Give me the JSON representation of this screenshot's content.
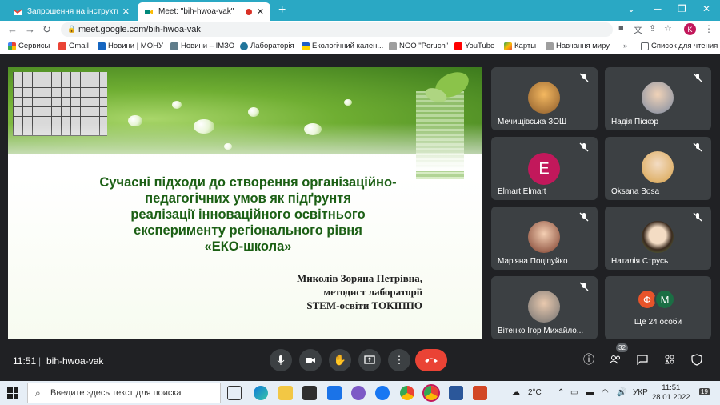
{
  "browser": {
    "tabs": [
      {
        "title": "Запрошення на інструктивно-м",
        "active": false,
        "icon": "gmail-icon"
      },
      {
        "title": "Meet: \"bih-hwoa-vak\"",
        "active": true,
        "icon": "meet-icon"
      }
    ],
    "url": "meet.google.com/bih-hwoa-vak",
    "profile_initial": "K",
    "bookmarks": [
      "Сервисы",
      "Gmail",
      "Новини | МОНУ",
      "Новини – ІМЗО",
      "Лабораторія",
      "Екологічний кален...",
      "NGO \"Poruch\"",
      "YouTube",
      "Карты",
      "Навчання миру"
    ],
    "reading_list": "Список для чтения"
  },
  "slide": {
    "title_lines": [
      "Сучасні підходи до створення організаційно-",
      "педагогічних умов як підґрунтя",
      "реалізації інноваційного освітнього",
      "експерименту регіонального рівня",
      "«ЕКО-школа»"
    ],
    "author_lines": [
      "Миколів Зоряна Петрівна,",
      "методист лабораторії",
      "STEM-освіти ТОКІППО"
    ]
  },
  "participants": [
    {
      "name": "Мечищівська ЗОШ",
      "avatar": "photo",
      "color": "#e0a040"
    },
    {
      "name": "Надія Піскор",
      "avatar": "photo",
      "color": "#b0b8c8"
    },
    {
      "name": "Elmart Elmart",
      "avatar": "letter",
      "letter": "E",
      "color": "#c2185b"
    },
    {
      "name": "Oksana Bosa",
      "avatar": "photo",
      "color": "#e8c070"
    },
    {
      "name": "Мар'яна Поціпуйко",
      "avatar": "photo",
      "color": "#d4956a"
    },
    {
      "name": "Наталія Струсь",
      "avatar": "photo",
      "color": "#6a8f4e"
    },
    {
      "name": "Вітенко Ігор Михайло...",
      "avatar": "photo",
      "color": "#9a9a9a"
    }
  ],
  "others": {
    "label": "Ще 24 особи",
    "avatars": [
      {
        "letter": "Ф",
        "color": "#e8542a"
      },
      {
        "letter": "М",
        "color": "#1b6e44"
      }
    ]
  },
  "controls": {
    "time": "11:51",
    "separator": "|",
    "meeting_code": "bih-hwoa-vak",
    "participant_count": "32"
  },
  "taskbar": {
    "search_placeholder": "Введите здесь текст для поиска",
    "weather": "2°C",
    "language": "УКР",
    "time": "11:51",
    "date": "28.01.2022",
    "notifications": "19"
  }
}
